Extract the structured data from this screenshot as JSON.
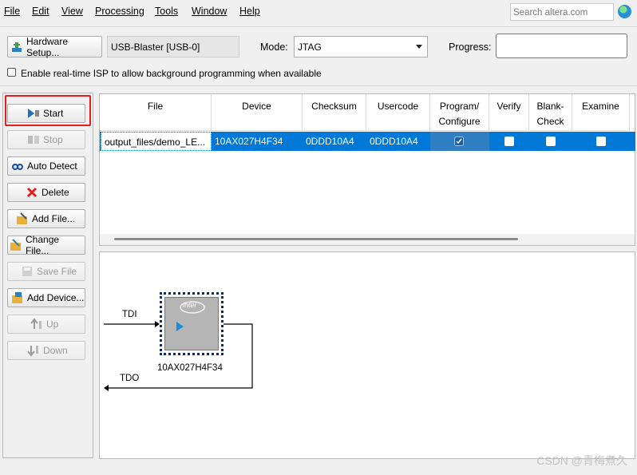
{
  "menu": {
    "items": [
      "File",
      "Edit",
      "View",
      "Processing",
      "Tools",
      "Window",
      "Help"
    ],
    "search_placeholder": "Search altera.com"
  },
  "toolbar": {
    "hardware_setup_label": "Hardware Setup...",
    "hardware_value": "USB-Blaster [USB-0]",
    "mode_label": "Mode:",
    "mode_value": "JTAG",
    "progress_label": "Progress:",
    "isp_checkbox_label": "Enable real-time ISP to allow background programming when available",
    "isp_checked": false
  },
  "side_buttons": [
    {
      "label": "Start",
      "enabled": true,
      "icon": "start-icon",
      "highlighted": true
    },
    {
      "label": "Stop",
      "enabled": false,
      "icon": "stop-icon"
    },
    {
      "label": "Auto Detect",
      "enabled": true,
      "icon": "auto-detect-icon"
    },
    {
      "label": "Delete",
      "enabled": true,
      "icon": "delete-icon"
    },
    {
      "label": "Add File...",
      "enabled": true,
      "icon": "add-file-icon"
    },
    {
      "label": "Change File...",
      "enabled": true,
      "icon": "change-file-icon"
    },
    {
      "label": "Save File",
      "enabled": false,
      "icon": "save-file-icon"
    },
    {
      "label": "Add Device...",
      "enabled": true,
      "icon": "add-device-icon"
    },
    {
      "label": "Up",
      "enabled": false,
      "icon": "up-icon"
    },
    {
      "label": "Down",
      "enabled": false,
      "icon": "down-icon"
    }
  ],
  "table": {
    "headers": {
      "file": "File",
      "device": "Device",
      "checksum": "Checksum",
      "usercode": "Usercode",
      "program_line1": "Program/",
      "program_line2": "Configure",
      "verify": "Verify",
      "blank_line1": "Blank-",
      "blank_line2": "Check",
      "examine": "Examine"
    },
    "rows": [
      {
        "file": "output_files/demo_LE...",
        "device": "10AX027H4F34",
        "checksum": "0DDD10A4",
        "usercode": "0DDD10A4",
        "program_configure": true,
        "verify": false,
        "blank_check": false,
        "examine": false
      }
    ]
  },
  "chain": {
    "tdi_label": "TDI",
    "tdo_label": "TDO",
    "device_label": "10AX027H4F34",
    "chip_logo": "intel"
  },
  "watermark": "CSDN @青梅煮久",
  "colors": {
    "selection": "#0078d7",
    "highlight_border": "#e02020"
  }
}
